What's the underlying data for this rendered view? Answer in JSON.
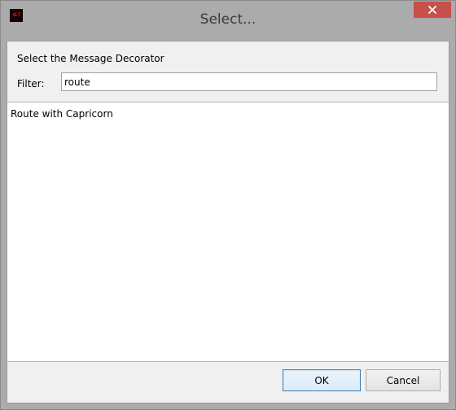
{
  "window": {
    "title": "Select...",
    "app_icon_text": "ALT",
    "app_icon_name": "app-icon",
    "close_icon_name": "close-icon"
  },
  "dialog": {
    "prompt": "Select the Message Decorator",
    "filter_label": "Filter:",
    "filter_value": "route",
    "items": [
      {
        "label": "Route with Capricorn"
      }
    ],
    "ok_label": "OK",
    "cancel_label": "Cancel"
  },
  "colors": {
    "close_button": "#c7504b",
    "titlebar": "#ababab",
    "client_bg": "#f0f0f0",
    "default_button_border": "#3c7fb1"
  }
}
